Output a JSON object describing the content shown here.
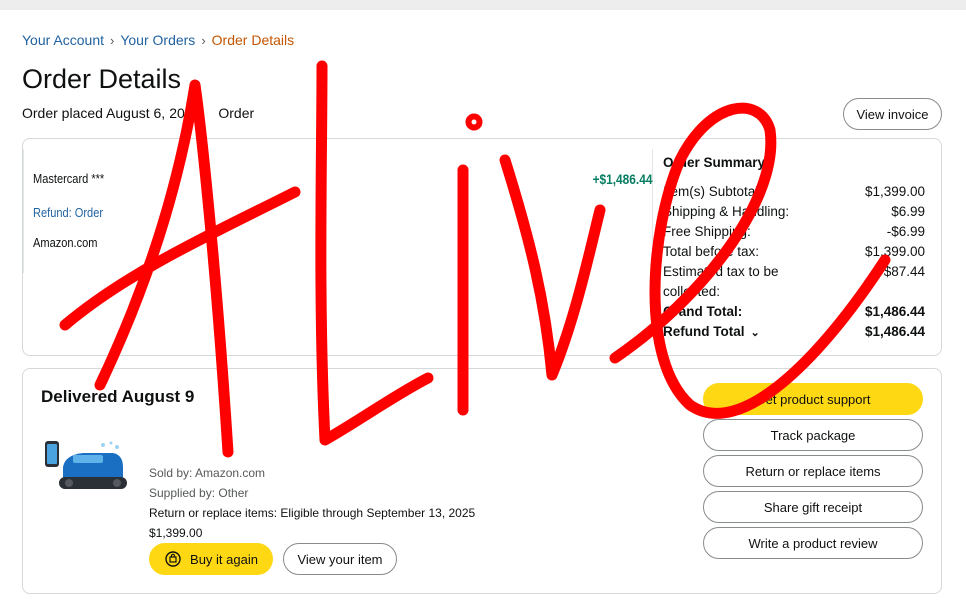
{
  "breadcrumb": {
    "items": [
      {
        "label": "Your Account"
      },
      {
        "label": "Your Orders"
      }
    ],
    "separator": "›",
    "current": "Order Details"
  },
  "header": {
    "title": "Order Details",
    "placed_prefix": "Order placed August 6,",
    "placed_year": "2025",
    "placed_order": "Order",
    "view_invoice": "View invoice"
  },
  "payment": {
    "card": "Mastercard ***",
    "refund": "Refund: Order",
    "merchant": "Amazon.com",
    "amount": "+$1,486.44"
  },
  "summary": {
    "title": "Order Summary",
    "rows": [
      {
        "label": "Item(s) Subtotal:",
        "value": "$1,399.00"
      },
      {
        "label": "Shipping & Handling:",
        "value": "$6.99"
      },
      {
        "label": "Free Shipping:",
        "value": "-$6.99"
      },
      {
        "label": "Total before tax:",
        "value": "$1,399.00"
      },
      {
        "label": "Estimated tax to be collected:",
        "value": "$87.44"
      },
      {
        "label": "Grand Total:",
        "value": "$1,486.44"
      },
      {
        "label": "Refund Total",
        "value": "$1,486.44"
      }
    ]
  },
  "shipment": {
    "delivered": "Delivered August 9",
    "sold_by": "Sold by: Amazon.com",
    "supplied_by": "Supplied by: Other",
    "return_window": "Return or replace items: Eligible through September 13, 2025",
    "price": "$1,399.00",
    "buy_again": "Buy it again",
    "view_item": "View your item"
  },
  "actions": {
    "product_support": "Get product support",
    "track_package": "Track package",
    "return_replace": "Return or replace items",
    "share_gift": "Share gift receipt",
    "write_review": "Write a product review"
  },
  "overlay": {
    "text": "ALIVE",
    "color": "#ff0000"
  },
  "colors": {
    "link": "#2162a1",
    "current_crumb": "#c45500",
    "refund_green": "#067d62",
    "button_yellow": "#ffd814"
  }
}
